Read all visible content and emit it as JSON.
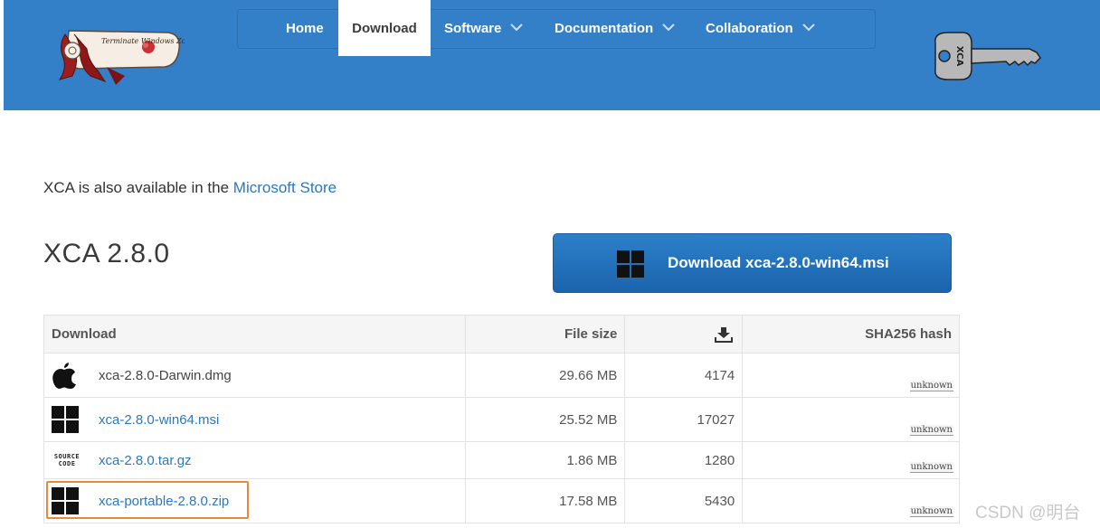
{
  "nav": {
    "home": "Home",
    "download": "Download",
    "software": "Software",
    "documentation": "Documentation",
    "collaboration": "Collaboration"
  },
  "logo_text": "Terminate Windows Zone",
  "key_text": "XCA",
  "notice": {
    "prefix": "XCA is also available in the ",
    "link": "Microsoft Store"
  },
  "version_title": "XCA 2.8.0",
  "download_button": "Download xca-2.8.0-win64.msi",
  "table": {
    "headers": {
      "download": "Download",
      "file_size": "File size",
      "hash": "SHA256 hash"
    },
    "rows": [
      {
        "icon": "apple-icon",
        "name": "xca-2.8.0-Darwin.dmg",
        "size": "29.66 MB",
        "count": "4174",
        "hash": "unknown"
      },
      {
        "icon": "windows-icon",
        "name": "xca-2.8.0-win64.msi",
        "size": "25.52 MB",
        "count": "17027",
        "hash": "unknown"
      },
      {
        "icon": "source-code-icon",
        "icon_text": "SOURCE CODE",
        "name": "xca-2.8.0.tar.gz",
        "size": "1.86 MB",
        "count": "1280",
        "hash": "unknown"
      },
      {
        "icon": "windows-icon",
        "name": "xca-portable-2.8.0.zip",
        "size": "17.58 MB",
        "count": "5430",
        "hash": "unknown"
      }
    ]
  },
  "watermark": "CSDN @明台",
  "colors": {
    "header": "#3380c8",
    "link": "#2a78c0",
    "highlight": "#e8893a",
    "button": "#1b64ad"
  }
}
